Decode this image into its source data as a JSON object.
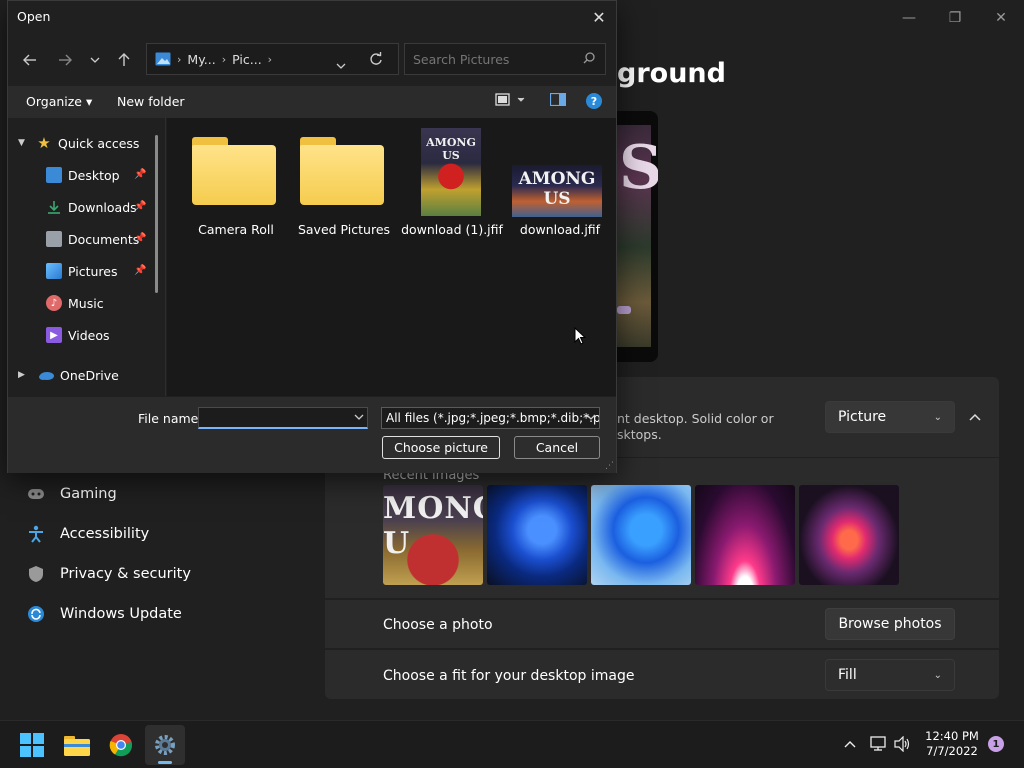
{
  "settings": {
    "heading": "ground",
    "window_controls": {
      "minimize": "—",
      "maximize": "❐",
      "close": "✕"
    },
    "personalize": {
      "description": "nt desktop. Solid color or\nsktops.",
      "dropdown_value": "Picture"
    },
    "recent_images_label": "Recent images",
    "thumb_text": "MONG U",
    "choose_photo": {
      "label": "Choose a photo",
      "button": "Browse photos"
    },
    "fit": {
      "label": "Choose a fit for your desktop image",
      "value": "Fill"
    },
    "nav": [
      {
        "label": "Gaming",
        "icon": "gamepad-icon"
      },
      {
        "label": "Accessibility",
        "icon": "accessibility-icon"
      },
      {
        "label": "Privacy & security",
        "icon": "shield-icon"
      },
      {
        "label": "Windows Update",
        "icon": "update-icon"
      }
    ]
  },
  "dialog": {
    "title": "Open",
    "close_glyph": "✕",
    "address": {
      "crumb1": "My...",
      "crumb2": "Pic...",
      "sep": "›"
    },
    "search_placeholder": "Search Pictures",
    "commands": {
      "organize": "Organize ▾",
      "new_folder": "New folder"
    },
    "tree": [
      {
        "label": "Quick access",
        "icon": "star-icon",
        "color": "#f0c040"
      },
      {
        "label": "Desktop",
        "icon": "desktop-icon",
        "color": "#3a8ad8",
        "pinned": true
      },
      {
        "label": "Downloads",
        "icon": "download-icon",
        "color": "#3aa870",
        "pinned": true
      },
      {
        "label": "Documents",
        "icon": "document-icon",
        "color": "#9aa0a8",
        "pinned": true
      },
      {
        "label": "Pictures",
        "icon": "pictures-icon",
        "color": "#3a8ad8",
        "pinned": true
      },
      {
        "label": "Music",
        "icon": "music-icon",
        "color": "#e06a6a"
      },
      {
        "label": "Videos",
        "icon": "video-icon",
        "color": "#8a5ae0"
      },
      {
        "label": "OneDrive",
        "icon": "cloud-icon",
        "color": "#3a8ad8"
      }
    ],
    "files": [
      {
        "name": "Camera Roll",
        "type": "folder"
      },
      {
        "name": "Saved Pictures",
        "type": "folder"
      },
      {
        "name": "download (1).jfif",
        "type": "image",
        "thumb_text": "AMONG US"
      },
      {
        "name": "download.jfif",
        "type": "image",
        "thumb_text": "AMONG US"
      }
    ],
    "file_name_label": "File name:",
    "file_name_value": "",
    "file_type": "All files (*.jpg;*.jpeg;*.bmp;*.dib;*.png",
    "choose_button": "Choose picture",
    "cancel_button": "Cancel"
  },
  "taskbar": {
    "apps": [
      "start-icon",
      "file-explorer-icon",
      "chrome-icon",
      "settings-icon"
    ],
    "time": "12:40 PM",
    "date": "7/7/2022",
    "notifications": "1"
  }
}
